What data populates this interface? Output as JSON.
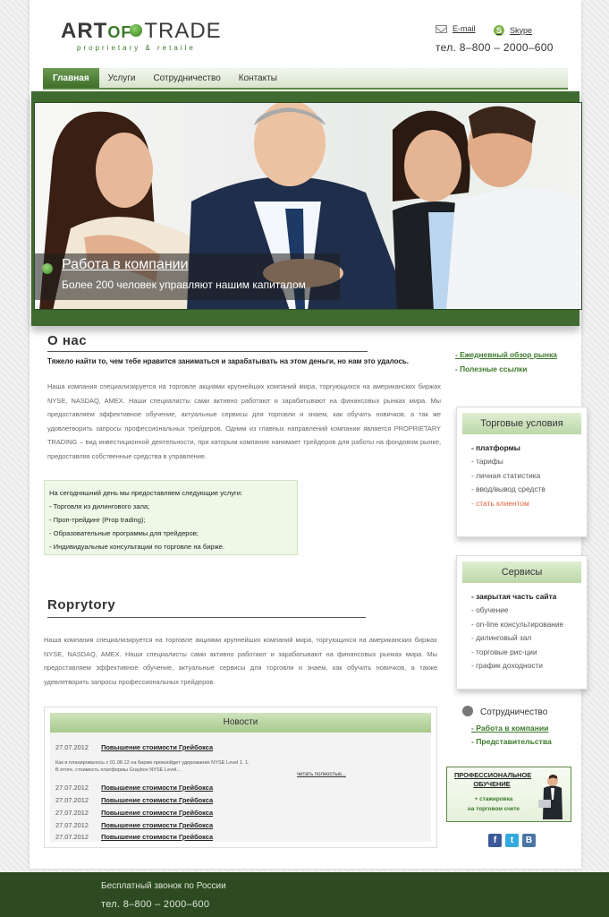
{
  "header": {
    "logo": {
      "art": "ART",
      "of": "OF",
      "trade": "TRADE",
      "tagline": "proprietary & retaile"
    },
    "email_label": "E-mail",
    "skype_label": "Skype",
    "phone": "тел. 8–800 – 2000–600"
  },
  "nav": {
    "items": [
      {
        "label": "Главная",
        "active": true
      },
      {
        "label": "Услуги",
        "active": false
      },
      {
        "label": "Сотрудничество",
        "active": false
      },
      {
        "label": "Контакты",
        "active": false
      }
    ]
  },
  "banner": {
    "title": "Работа в компании",
    "subtitle": "Более 200 человек управляют нашим капиталом"
  },
  "about": {
    "title": "О нас",
    "lead": "Тяжело найти то, чем тебе нравится заниматься и зарабатывать на этом деньги, но нам это удалось.",
    "body": "Наша компания специализируется на торговле акциями крупнейших компаний мира, торгующихся на американских биржах NYSE, NASDAQ, AMEX. Наши специалисты сами активно работают и зарабатывают на финансовых рынках мира. Мы предоставляем эффективное обучение, актуальные сервисы для торговли и знаем, как обучить новичков, а так же удовлетворить запросы профессиональных трейдеров. Одним из главных направлений компании является PROPRIETARY TRADING – вид инвестиционной деятельности, при каторым компания нанимает трейдеров для работы на фондовом рынке, предоставляя собственные средства в управление.",
    "services_intro": "На сегодняшний день мы предоставляем следующие услуги:",
    "services": [
      "- Торговля из дилингового зала;",
      "- Проп-трейдинг (Prop trading);",
      "- Образовательные программы для трейдеров;",
      "- Индивидуальные консультации по торговле на бирже."
    ]
  },
  "second": {
    "title": "Roprytory",
    "body": "Наша компания специализируется на торговле акциями крупнейших компаний мира, торгующихся на американских биржах NYSE, NASDAQ, AMEX. Наши специалисты сами активно работают и зарабатывают на финансовых рынках мира. Мы предоставляем эффективное обучение, актуальные сервисы для торговли и знаем, как обучить новичков, а также удевлетворить запросы профессиональных трейдеров."
  },
  "news": {
    "title": "Новости",
    "first": {
      "date": "27.07.2012",
      "link": "Повышение стоимости Грейбокса",
      "desc_line1": "Как и планировалось с 01.08.12 на бирже произойдет удорожание NYSE Level 1. 1.",
      "desc_line2": "В итоге, стоимость платформы Graybox NYSE Level...",
      "more": "читать полностью..."
    },
    "items": [
      {
        "date": "27.07.2012",
        "link": "Повышение стоимости Грейбокса"
      },
      {
        "date": "27.07.2012",
        "link": "Повышение стоимости Грейбокса"
      },
      {
        "date": "27.07.2012",
        "link": "Повышение стоимости Грейбокса"
      },
      {
        "date": "27.07.2012",
        "link": "Повышение стоимости Грейбокса"
      },
      {
        "date": "27.07.2012",
        "link": "Повышение стоимости Грейбокса"
      }
    ]
  },
  "sidebar": {
    "links": [
      "- Ежедневный обзор рынка",
      "- Полезные ссылки"
    ],
    "trading": {
      "title": "Торговые условия",
      "items": [
        "- платформы",
        "- тарифы",
        "- личная статистика",
        "- ввод/вывод средств",
        "- стать клиентом"
      ]
    },
    "services": {
      "title": "Сервисы",
      "items": [
        "- закрытая часть сайта",
        "- обучение",
        "- on-line консультирование",
        "- дилинговый зал",
        "- торговые рис-ции",
        "- график доходности"
      ]
    },
    "coop": {
      "title": "Сотрудничество",
      "links": [
        "- Работа в компании",
        "- Представительства"
      ]
    },
    "promo": {
      "title": "ПРОФЕССИОНАЛЬНОЕ ОБУЧЕНИЕ",
      "line1": "+ стажировка",
      "line2": "на торговом счете"
    },
    "socials": [
      {
        "icon": "facebook-icon",
        "glyph": "f",
        "color": "#3b5998"
      },
      {
        "icon": "twitter-icon",
        "glyph": "t",
        "color": "#33aadd"
      },
      {
        "icon": "vk-icon",
        "glyph": "B",
        "color": "#4c75a3"
      }
    ]
  },
  "footer": {
    "note": "Бесплатный звонок по России",
    "phone": "тел. 8–800 – 2000–600"
  },
  "colors": {
    "accent": "#3b7a2a",
    "dark_green": "#2d4a22",
    "orange": "#e4613a"
  }
}
